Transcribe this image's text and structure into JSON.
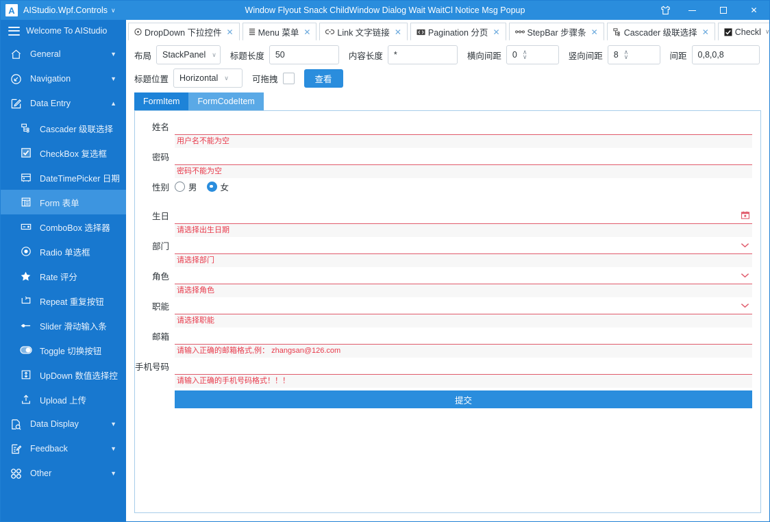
{
  "titlebar": {
    "logo": "A",
    "app_name": "AIStudio.Wpf.Controls",
    "app_chevron": "∨",
    "window_title": "Window Flyout Snack ChildWindow Dialog Wait WaitCl Notice Msg Popup",
    "theme_icon": "shirt-icon",
    "minimize": "–",
    "maximize": "□",
    "close": "✕",
    "background": "#2a8ddd"
  },
  "sidebar": {
    "header_label": "Welcome To AIStudio",
    "background": "#1878cf",
    "active_background": "#3d95e0",
    "groups": [
      {
        "label": "General",
        "icon": "home-icon",
        "chevron": "▼",
        "expanded": false
      },
      {
        "label": "Navigation",
        "icon": "navigate-icon",
        "chevron": "▼",
        "expanded": false
      },
      {
        "label": "Data Entry",
        "icon": "edit-icon",
        "chevron": "▲",
        "expanded": true
      }
    ],
    "items": [
      {
        "label": "Cascader 级联选择",
        "icon": "cascader-icon",
        "active": false
      },
      {
        "label": "CheckBox 复选框",
        "icon": "checkbox-icon",
        "active": false
      },
      {
        "label": "DateTimePicker 日期",
        "icon": "calendar-icon",
        "active": false
      },
      {
        "label": "Form 表单",
        "icon": "form-icon",
        "active": true
      },
      {
        "label": "ComboBox 选择器",
        "icon": "combobox-icon",
        "active": false
      },
      {
        "label": "Radio 单选框",
        "icon": "radio-icon",
        "active": false
      },
      {
        "label": "Rate 评分",
        "icon": "star-icon",
        "active": false
      },
      {
        "label": "Repeat 重复按钮",
        "icon": "repeat-icon",
        "active": false
      },
      {
        "label": "Slider 滑动输入条",
        "icon": "slider-icon",
        "active": false
      },
      {
        "label": "Toggle 切换按钮",
        "icon": "toggle-icon",
        "active": false
      },
      {
        "label": "UpDown 数值选择控",
        "icon": "updown-icon",
        "active": false
      },
      {
        "label": "Upload 上传",
        "icon": "upload-icon",
        "active": false
      }
    ],
    "groups_bottom": [
      {
        "label": "Data Display",
        "icon": "document-search-icon",
        "chevron": "▼"
      },
      {
        "label": "Feedback",
        "icon": "feedback-icon",
        "chevron": "▼"
      },
      {
        "label": "Other",
        "icon": "grid-icon",
        "chevron": "▼"
      }
    ]
  },
  "tabs": [
    {
      "label": "DropDown 下拉控件",
      "icon": "dropdown-icon",
      "close": "✕",
      "active": false
    },
    {
      "label": "Menu 菜单",
      "icon": "menu-icon",
      "close": "✕",
      "active": false
    },
    {
      "label": "Link 文字链接",
      "icon": "link-icon",
      "close": "✕",
      "active": false
    },
    {
      "label": "Pagination 分页",
      "icon": "pagination-icon",
      "close": "✕",
      "active": false
    },
    {
      "label": "StepBar 步骤条",
      "icon": "stepbar-icon",
      "close": "✕",
      "active": false
    },
    {
      "label": "Cascader 级联选择",
      "icon": "cascader-icon",
      "close": "✕",
      "active": false
    },
    {
      "label": "Checkl",
      "icon": "checkbox-icon",
      "chevron": "∨",
      "active": false
    }
  ],
  "toolbar": {
    "row1": {
      "layout_label": "布局",
      "layout_value": "StackPanel",
      "layout_chevron": "∨",
      "title_len_label": "标题长度",
      "title_len_value": "50",
      "content_len_label": "内容长度",
      "content_len_value": "*",
      "h_gap_label": "横向间距",
      "h_gap_value": "0",
      "v_gap_label": "竖向间距",
      "v_gap_value": "8",
      "margin_label": "间距",
      "margin_value": "0,8,0,8",
      "spin_up": "∧",
      "spin_down": "∨"
    },
    "row2": {
      "title_pos_label": "标题位置",
      "title_pos_value": "Horizontal",
      "title_pos_chevron": "∨",
      "draggable_label": "可拖拽",
      "draggable_checked": false,
      "view_button": "查看"
    }
  },
  "inner_tabs": [
    {
      "label": "FormItem",
      "active": true
    },
    {
      "label": "FormCodeItem",
      "active": false
    }
  ],
  "form": {
    "error_color": "#e8394a",
    "fields": [
      {
        "label": "姓名",
        "type": "text",
        "value": "",
        "error": "用户名不能为空"
      },
      {
        "label": "密码",
        "type": "password",
        "value": "",
        "error": "密码不能为空"
      }
    ],
    "gender": {
      "label": "性别",
      "options": [
        {
          "label": "男",
          "selected": false
        },
        {
          "label": "女",
          "selected": true
        }
      ]
    },
    "fields2": [
      {
        "label": "生日",
        "type": "date",
        "value": "",
        "icon": "calendar-icon",
        "error": "请选择出生日期"
      },
      {
        "label": "部门",
        "type": "select",
        "value": "",
        "icon": "chevron-down-icon",
        "error": "请选择部门"
      },
      {
        "label": "角色",
        "type": "select",
        "value": "",
        "icon": "chevron-down-icon",
        "error": "请选择角色"
      },
      {
        "label": "职能",
        "type": "select",
        "value": "",
        "icon": "chevron-down-icon",
        "error": "请选择职能"
      },
      {
        "label": "邮箱",
        "type": "text",
        "value": "",
        "icon": "",
        "error": "请输入正确的邮箱格式,例： zhangsan@126.com"
      },
      {
        "label": "手机号码",
        "type": "text",
        "value": "",
        "icon": "",
        "error": "请输入正确的手机号码格式！！！"
      }
    ],
    "submit_label": "提交"
  }
}
